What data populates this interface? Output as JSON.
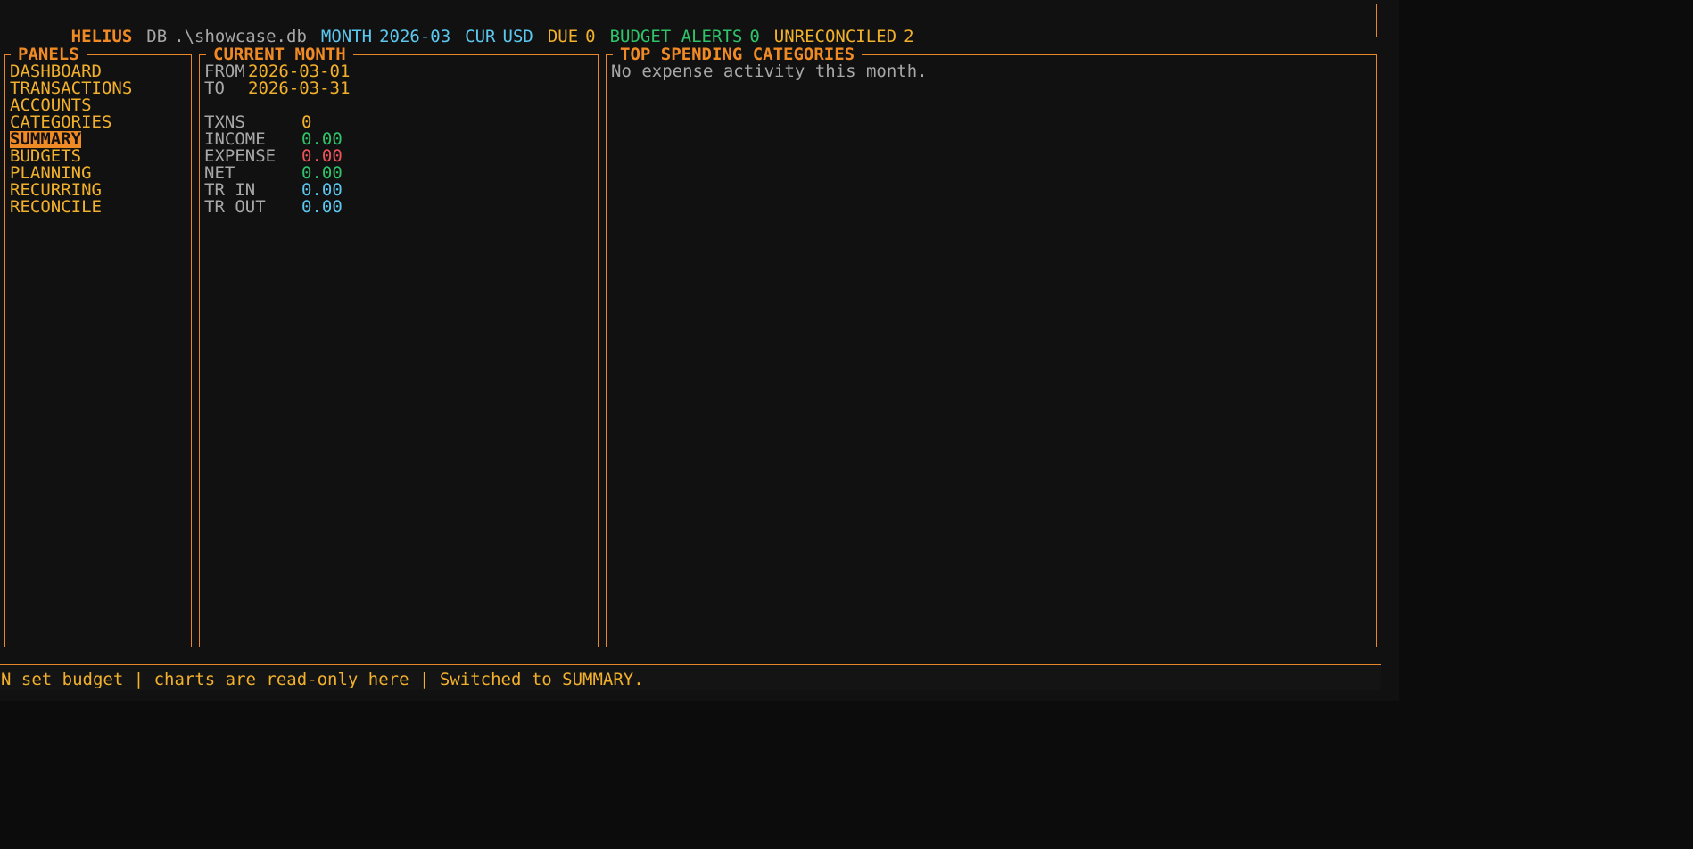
{
  "header": {
    "app_name": "HELIUS",
    "db_label": "DB",
    "db_path": ".\\showcase.db",
    "month_label": "MONTH",
    "month_value": "2026-03",
    "currency_label": "CUR",
    "currency_value": "USD",
    "due_label": "DUE",
    "due_value": "0",
    "budget_alerts_label": "BUDGET ALERTS",
    "budget_alerts_value": "0",
    "unreconciled_label": "UNRECONCILED",
    "unreconciled_value": "2"
  },
  "panels": {
    "title": "PANELS",
    "items": [
      {
        "label": "DASHBOARD"
      },
      {
        "label": "TRANSACTIONS"
      },
      {
        "label": "ACCOUNTS"
      },
      {
        "label": "CATEGORIES"
      },
      {
        "label": "SUMMARY"
      },
      {
        "label": "BUDGETS"
      },
      {
        "label": "PLANNING"
      },
      {
        "label": "RECURRING"
      },
      {
        "label": "RECONCILE"
      }
    ],
    "selected": "SUMMARY"
  },
  "current_month": {
    "title": "CURRENT MONTH",
    "from_label": "FROM",
    "from_value": "2026-03-01",
    "to_label": "TO",
    "to_value": "2026-03-31",
    "stats": [
      {
        "label": "TXNS",
        "value": "0"
      },
      {
        "label": "INCOME",
        "value": "0.00"
      },
      {
        "label": "EXPENSE",
        "value": "0.00"
      },
      {
        "label": "NET",
        "value": "0.00"
      },
      {
        "label": "TR IN",
        "value": "0.00"
      },
      {
        "label": "TR OUT",
        "value": "0.00"
      }
    ]
  },
  "top_spending": {
    "title": "TOP SPENDING CATEGORIES",
    "empty_message": "No expense activity this month."
  },
  "status_bar": {
    "text": "N set budget | charts are read-only here | Switched to SUMMARY."
  },
  "colors": {
    "accent": "#f08a24",
    "label_yellow": "#f2b12c",
    "info_cyan": "#5cc8f0",
    "positive_green": "#2ec46a",
    "negative_red": "#f0525a",
    "background": "#111111"
  }
}
